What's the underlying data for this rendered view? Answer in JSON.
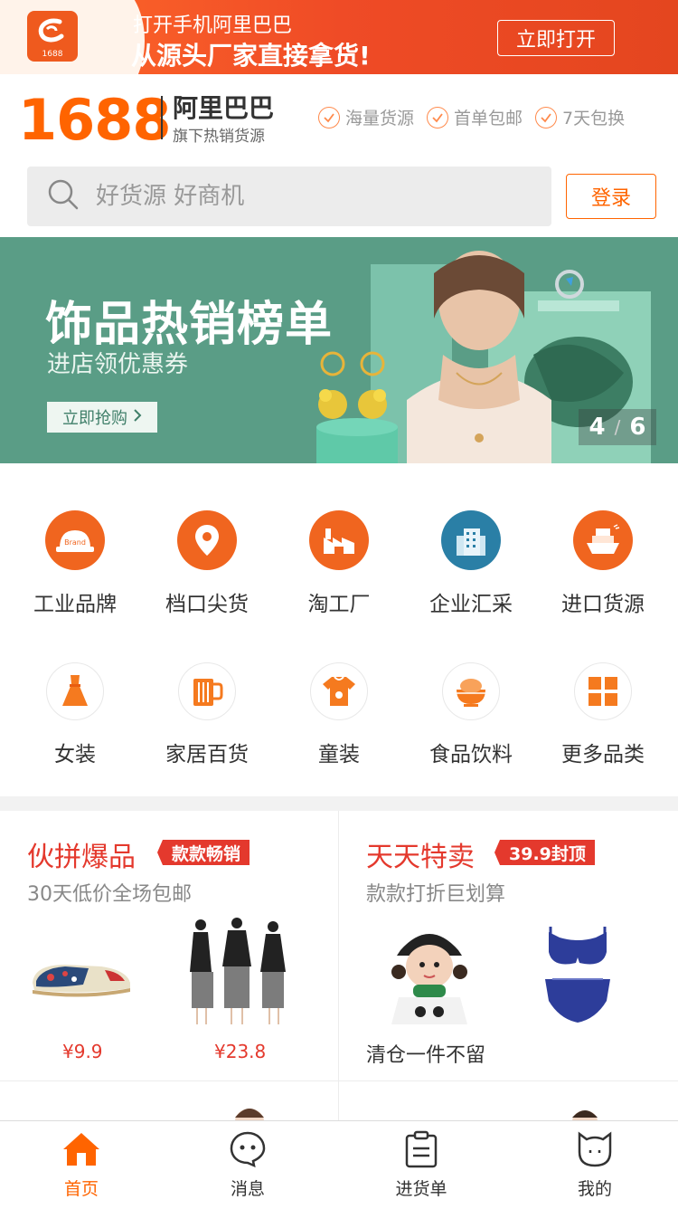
{
  "app_banner": {
    "logo_text": "1688",
    "line1": "打开手机阿里巴巴",
    "line2": "从源头厂家直接拿货!",
    "open_button": "立即打开"
  },
  "brand": {
    "logo": "1688",
    "name": "阿里巴巴",
    "subtitle": "旗下热销货源",
    "perks": [
      "海量货源",
      "首单包邮",
      "7天包换"
    ]
  },
  "search": {
    "placeholder": "好货源 好商机",
    "login_button": "登录"
  },
  "hero": {
    "title": "饰品热销榜单",
    "subtitle": "进店领优惠券",
    "cta": "立即抢购",
    "current_slide": "4",
    "total_slides": "6"
  },
  "categories": {
    "row1": [
      {
        "label": "工业品牌",
        "icon": "hard-hat-icon",
        "color": "#f0651f"
      },
      {
        "label": "档口尖货",
        "icon": "location-pin-icon",
        "color": "#f0651f"
      },
      {
        "label": "淘工厂",
        "icon": "factory-icon",
        "color": "#f0651f"
      },
      {
        "label": "企业汇采",
        "icon": "building-icon",
        "color": "#2a7fa6"
      },
      {
        "label": "进口货源",
        "icon": "ship-icon",
        "color": "#f0651f"
      }
    ],
    "row2": [
      {
        "label": "女装",
        "icon": "dress-icon"
      },
      {
        "label": "家居百货",
        "icon": "mug-icon"
      },
      {
        "label": "童装",
        "icon": "baby-clothes-icon"
      },
      {
        "label": "食品饮料",
        "icon": "bowl-icon"
      },
      {
        "label": "更多品类",
        "icon": "grid-icon"
      }
    ]
  },
  "promos": {
    "left": {
      "title": "伙拼爆品",
      "badge": "款款畅销",
      "subtitle": "30天低价全场包邮",
      "price1": "¥9.9",
      "price2": "¥23.8"
    },
    "right": {
      "title": "天天特卖",
      "badge": "39.9封顶",
      "subtitle": "款款打折巨划算",
      "footer": "清仓一件不留"
    }
  },
  "tabbar": [
    {
      "label": "首页",
      "icon": "home-icon",
      "active": true
    },
    {
      "label": "消息",
      "icon": "message-icon",
      "active": false
    },
    {
      "label": "进货单",
      "icon": "clipboard-icon",
      "active": false
    },
    {
      "label": "我的",
      "icon": "profile-icon",
      "active": false
    }
  ],
  "colors": {
    "brand_orange": "#ff6400",
    "promo_red": "#e4392d",
    "hero_green": "#5a9d86"
  }
}
